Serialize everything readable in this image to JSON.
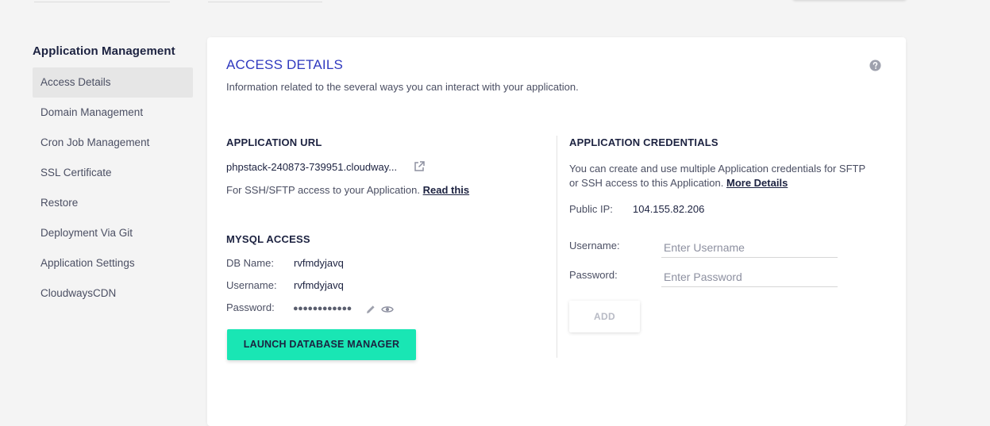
{
  "sidebar": {
    "title": "Application Management",
    "items": [
      {
        "label": "Access Details"
      },
      {
        "label": "Domain Management"
      },
      {
        "label": "Cron Job Management"
      },
      {
        "label": "SSL Certificate"
      },
      {
        "label": "Restore"
      },
      {
        "label": "Deployment Via Git"
      },
      {
        "label": "Application Settings"
      },
      {
        "label": "CloudwaysCDN"
      }
    ]
  },
  "card": {
    "title": "ACCESS DETAILS",
    "subtitle": "Information related to the several ways you can interact with your application.",
    "help_icon": "question-circle-icon"
  },
  "app_url": {
    "heading": "APPLICATION URL",
    "url": "phpstack-240873-739951.cloudway...",
    "ssh_text": "For SSH/SFTP access to your Application.",
    "ssh_link": "Read this",
    "external_icon": "external-link-icon"
  },
  "mysql": {
    "heading": "MYSQL ACCESS",
    "db_name_label": "DB Name:",
    "db_name": "rvfmdyjavq",
    "username_label": "Username:",
    "username": "rvfmdyjavq",
    "password_label": "Password:",
    "password_masked": "●●●●●●●●●●●●",
    "edit_icon": "pencil-icon",
    "view_icon": "eye-icon",
    "launch_button": "LAUNCH DATABASE MANAGER"
  },
  "credentials": {
    "heading": "APPLICATION CREDENTIALS",
    "desc_line1": "You can create and use multiple Application credentials for SFTP",
    "desc_line2": "or SSH access to this Application.",
    "more_link": "More Details",
    "public_ip_label": "Public IP:",
    "public_ip": "104.155.82.206",
    "username_label": "Username:",
    "username_placeholder": "Enter Username",
    "password_label": "Password:",
    "password_placeholder": "Enter Password",
    "add_button": "ADD"
  },
  "colors": {
    "accent_title": "#2f39bf",
    "launch_button": "#19e6b4",
    "text_dark": "#1c2240"
  }
}
